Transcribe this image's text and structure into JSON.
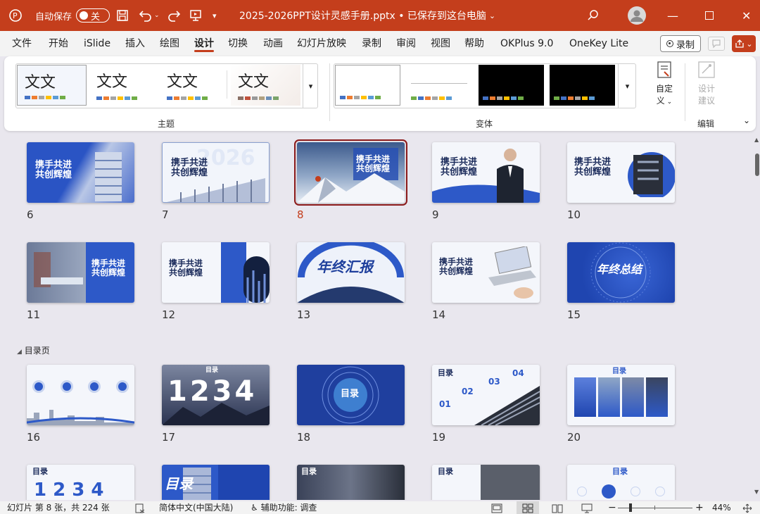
{
  "titlebar": {
    "autosave_label": "自动保存",
    "autosave_toggle": "关",
    "doc_title": "2025-2026PPT设计灵感手册.pptx • 已保存到这台电脑"
  },
  "menu": [
    "文件",
    "开始",
    "iSlide",
    "插入",
    "绘图",
    "设计",
    "切换",
    "动画",
    "幻灯片放映",
    "录制",
    "审阅",
    "视图",
    "帮助",
    "OKPlus 9.0",
    "OneKey Lite"
  ],
  "record_button": "录制",
  "ribbon": {
    "themes": [
      {
        "text": "文文"
      },
      {
        "text": "文文"
      },
      {
        "text": "文文"
      },
      {
        "text": "文文"
      }
    ],
    "themes_label": "主题",
    "variants_label": "变体",
    "customize_label_1": "自定",
    "customize_label_2": "义",
    "designer_label_1": "设计",
    "designer_label_2": "建议",
    "edit_label": "编辑"
  },
  "sections": {
    "toc": "目录页"
  },
  "slides_row1": [
    {
      "num": "6",
      "title": "携手共进\n共创辉煌"
    },
    {
      "num": "7",
      "title": "携手共进\n共创辉煌"
    },
    {
      "num": "8",
      "title": "携手共进\n共创辉煌"
    },
    {
      "num": "9",
      "title": "携手共进\n共创辉煌"
    },
    {
      "num": "10",
      "title": "携手共进\n共创辉煌"
    }
  ],
  "slides_row2": [
    {
      "num": "11",
      "title": "携手共进\n共创辉煌"
    },
    {
      "num": "12",
      "title": "携手共进\n共创辉煌"
    },
    {
      "num": "13",
      "title": "年终汇报"
    },
    {
      "num": "14",
      "title": "携手共进\n共创辉煌"
    },
    {
      "num": "15",
      "title": "年终总结"
    }
  ],
  "slides_row3": [
    {
      "num": "16",
      "title": ""
    },
    {
      "num": "17",
      "title": "1234",
      "sub": "目录"
    },
    {
      "num": "18",
      "title": "目录"
    },
    {
      "num": "19",
      "title": "目录"
    },
    {
      "num": "20",
      "title": "目录"
    }
  ],
  "slides_row4": [
    {
      "title": "目录",
      "big": "1 2 3 4"
    },
    {
      "title": "目录"
    },
    {
      "title": "目录"
    },
    {
      "title": "目录"
    },
    {
      "title": "目录"
    }
  ],
  "statusbar": {
    "slide_info": "幻灯片 第 8 张，共 224 张",
    "language": "简体中文(中国大陆)",
    "accessibility": "辅助功能: 调查",
    "zoom": "44%"
  },
  "colors": {
    "accent": "#c43e1c",
    "slide_blue": "#2d59c8",
    "selected_outline": "#8b1a1a"
  },
  "selected_slide": 8
}
